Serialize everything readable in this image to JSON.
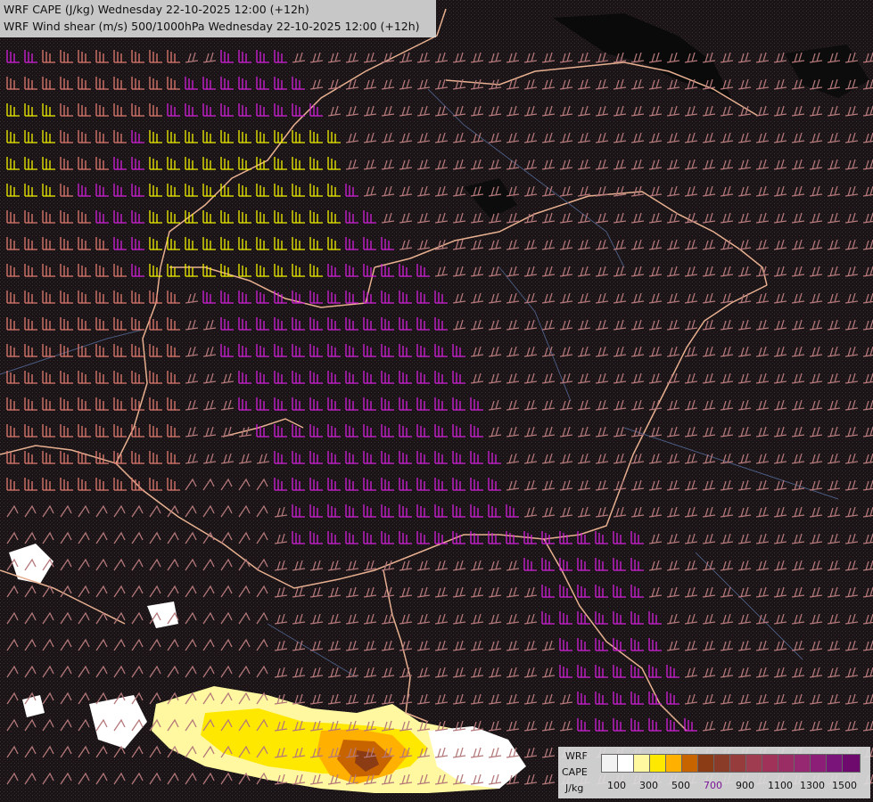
{
  "header": {
    "line1": "WRF CAPE (J/kg) Wednesday 22-10-2025 12:00 (+12h)",
    "line2": "WRF Wind shear (m/s) 500/1000hPa Wednesday 22-10-2025 12:00 (+12h)"
  },
  "legend": {
    "title1": "WRF",
    "title2": "CAPE",
    "unit": "J/kg",
    "swatch_colors": [
      "#f2f2f2",
      "#ffffff",
      "#fff8a0",
      "#ffe800",
      "#ffb000",
      "#c86400",
      "#8c3c14",
      "#8a3c28",
      "#963c3c",
      "#a03c50",
      "#a0325a",
      "#9a2d64",
      "#962872",
      "#8c1e78",
      "#7a147a",
      "#6e0a6e"
    ],
    "ticks": [
      "100",
      "300",
      "500",
      "700",
      "900",
      "1100",
      "1300",
      "1500"
    ],
    "highlight_tick": "700",
    "highlight_color": "#7a1496"
  },
  "map_colors": {
    "background": "#1a1416",
    "barb_default": "#b4787a",
    "barb_salmon": "#e07a70",
    "barb_magenta": "#d020d8",
    "barb_yellow": "#f0f000",
    "border": "#e8b090",
    "river": "#4a5a80"
  }
}
